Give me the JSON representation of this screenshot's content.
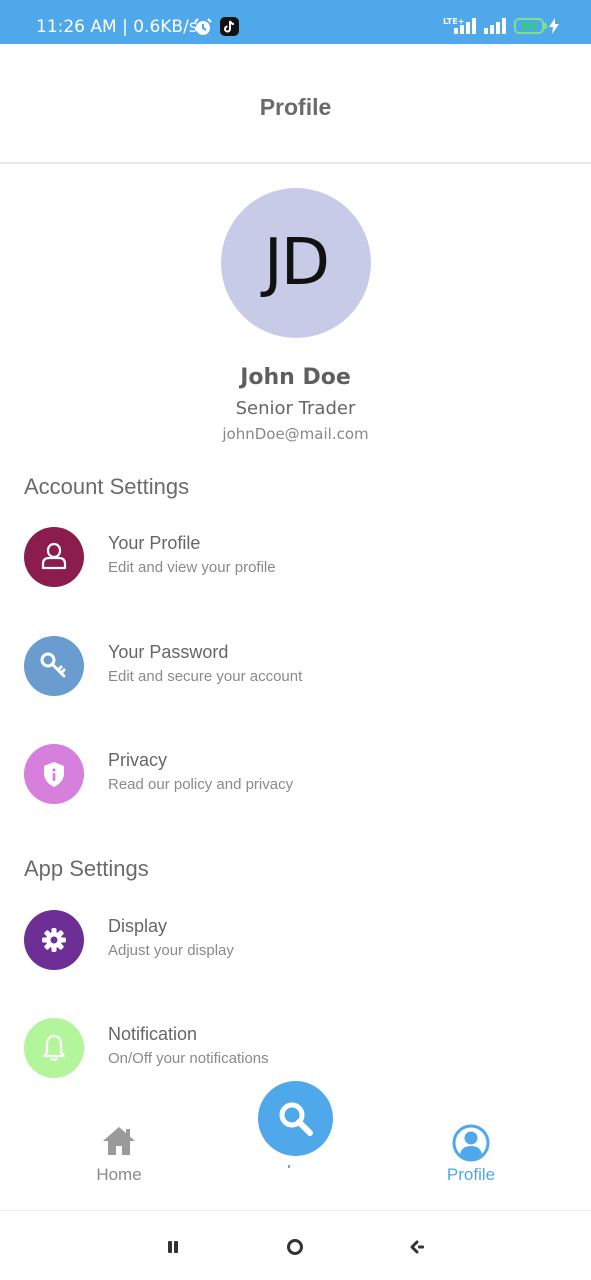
{
  "status_bar": {
    "time_speed": "11:26 AM | 0.6KB/s",
    "network_label": "LTE+",
    "battery": "80",
    "alarm_icon": "alarm-clock-icon",
    "tiktok_icon": "tiktok-icon",
    "charge_icon": "lightning-icon"
  },
  "header": {
    "title": "Profile"
  },
  "profile": {
    "initials": "JD",
    "name": "John Doe",
    "role": "Senior Trader",
    "email": "johnDoe@mail.com"
  },
  "account_settings": {
    "title": "Account Settings",
    "items": [
      {
        "title": "Your Profile",
        "subtitle": "Edit and view your profile",
        "icon": "user-icon",
        "color": "#8b1c4e"
      },
      {
        "title": "Your Password",
        "subtitle": "Edit and secure your account",
        "icon": "key-icon",
        "color": "#6a9ccf"
      },
      {
        "title": "Privacy",
        "subtitle": "Read our policy and privacy",
        "icon": "shield-icon",
        "color": "#d77fdc"
      }
    ]
  },
  "app_settings": {
    "title": "App Settings",
    "items": [
      {
        "title": "Display",
        "subtitle": "Adjust your display",
        "icon": "gear-icon",
        "color": "#6d2f95"
      },
      {
        "title": "Notification",
        "subtitle": "On/Off your notifications",
        "icon": "bell-icon",
        "color": "#b2f59a"
      }
    ]
  },
  "bottom_nav": {
    "home_label": "Home",
    "profile_label": "Profile",
    "search_icon": "search-icon",
    "active": "Profile",
    "active_color": "#4fa8ea",
    "inactive_color": "#8a8a8a"
  },
  "system_nav": {
    "recents_icon": "recents-icon",
    "home_icon": "home-circle-icon",
    "back_icon": "back-icon"
  }
}
